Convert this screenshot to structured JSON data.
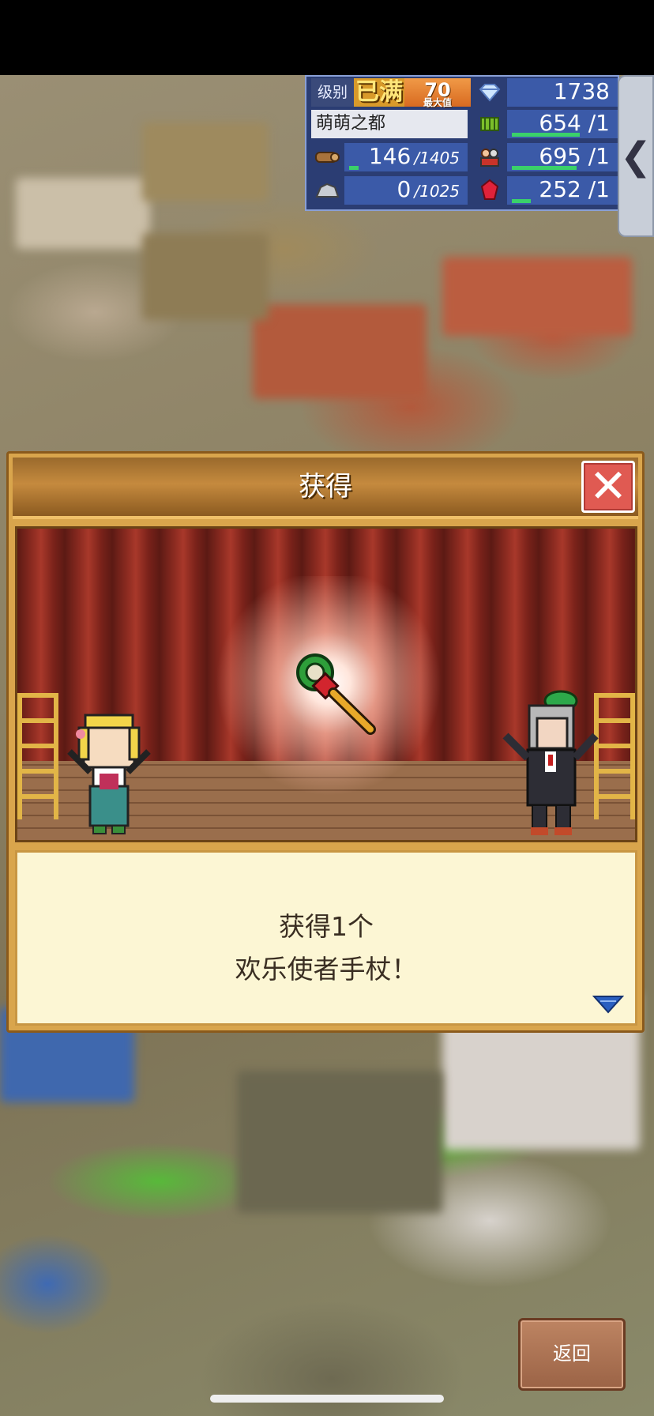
{
  "hud": {
    "level_label": "级别",
    "level_value": "已满",
    "level_number": "70",
    "level_sub": "最大值",
    "diamonds": "1738",
    "city_name": "萌萌之都",
    "food": "654 /1",
    "wood": "146",
    "wood_cap": "/1405",
    "people": "695 /1",
    "stone": "0",
    "stone_cap": "/1025",
    "ruby": "252 /1",
    "colors": {
      "panel": "#2b3d73",
      "value_bg": "#3b5aa8",
      "bar": "#3ad16a",
      "level_bg": "#d89a2a"
    }
  },
  "side_tab": {
    "icon": "chevron-left-icon",
    "glyph": "❮"
  },
  "dialog": {
    "title": "获得",
    "close_glyph": "✕",
    "message_line1": "获得1个",
    "message_line2": "欢乐使者手杖！",
    "next_icon": "triangle-down-icon"
  },
  "back_button": {
    "label": "返回"
  }
}
